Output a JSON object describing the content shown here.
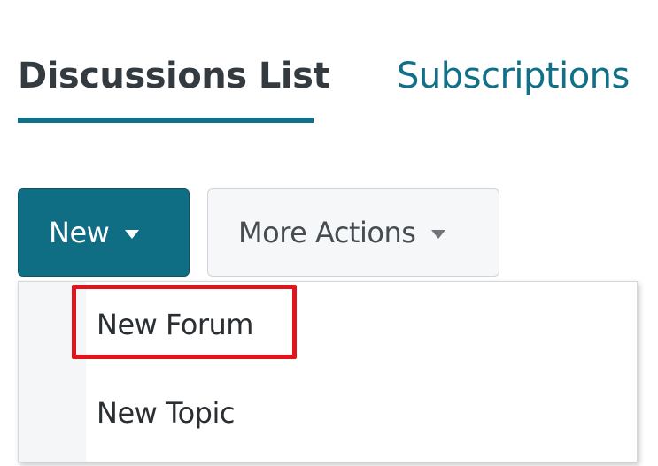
{
  "tabs": [
    {
      "label": "Discussions List",
      "active": true
    },
    {
      "label": "Subscriptions",
      "active": false
    }
  ],
  "toolbar": {
    "new_label": "New",
    "more_actions_label": "More Actions"
  },
  "new_menu": {
    "items": [
      {
        "label": "New Forum",
        "highlighted": true
      },
      {
        "label": "New Topic",
        "highlighted": false
      }
    ]
  },
  "colors": {
    "accent": "#0f6d84",
    "tab_link": "#0f7088",
    "highlight": "#e0141b"
  },
  "icons": {
    "caret": "caret-down-icon"
  }
}
